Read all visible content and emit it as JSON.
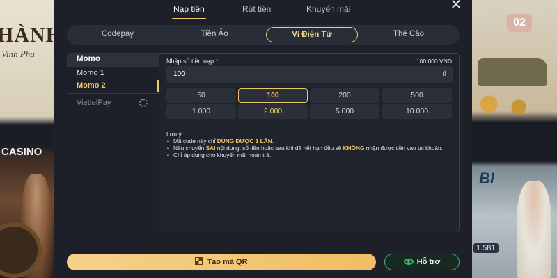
{
  "background": {
    "left_text_1": "HÀNH",
    "left_text_2": "Vinh Phụ",
    "left_casino": "CASINO",
    "right_badge": "02",
    "right_logo": "BI",
    "right_number": "1.581"
  },
  "top_tabs": [
    {
      "label": "Nạp tiền",
      "active": true
    },
    {
      "label": "Rút tiền",
      "active": false
    },
    {
      "label": "Khuyến mãi",
      "active": false
    }
  ],
  "close_icon": "close-icon",
  "methods": [
    {
      "label": "Codepay",
      "active": false
    },
    {
      "label": "Tiền Ảo",
      "active": false
    },
    {
      "label": "Ví Điện Tử",
      "active": true
    },
    {
      "label": "Thẻ Cào",
      "active": false
    }
  ],
  "side": {
    "header": "Momo",
    "items": [
      {
        "label": "Momo 1",
        "active": false
      },
      {
        "label": "Momo 2",
        "active": true
      }
    ],
    "viettel": "ViettelPay",
    "viettel_icon": "gear-icon"
  },
  "form": {
    "amount_label": "Nhập số tiền nạp",
    "required_mark": "*",
    "max_label": "100.000 VND",
    "amount_value": "100",
    "amount_unit": "đ",
    "chips": [
      {
        "label": "50"
      },
      {
        "label": "100"
      },
      {
        "label": "200"
      },
      {
        "label": "500"
      },
      {
        "label": "1.000"
      },
      {
        "label": "2.000"
      },
      {
        "label": "5.000"
      },
      {
        "label": "10.000"
      }
    ]
  },
  "notes": {
    "title": "Lưu ý:",
    "line1_a": "Mã code này chỉ ",
    "line1_b": "DÙNG ĐƯỢC 1 LẦN",
    "line1_c": ".",
    "line2_a": "Nếu chuyển ",
    "line2_b": "SAI",
    "line2_c": " nội dung, số tiền hoặc sau khi đã hết hạn đều sẽ ",
    "line2_d": "KHÔNG",
    "line2_e": " nhận được tiền vào tài khoản.",
    "line3": "Chỉ áp dụng cho khuyến mãi hoàn trả."
  },
  "buttons": {
    "qr_label": "Tạo mã QR",
    "help_label": "Hỗ trợ"
  },
  "colors": {
    "accent": "#f0c76a",
    "help_green": "#3dbb74"
  }
}
